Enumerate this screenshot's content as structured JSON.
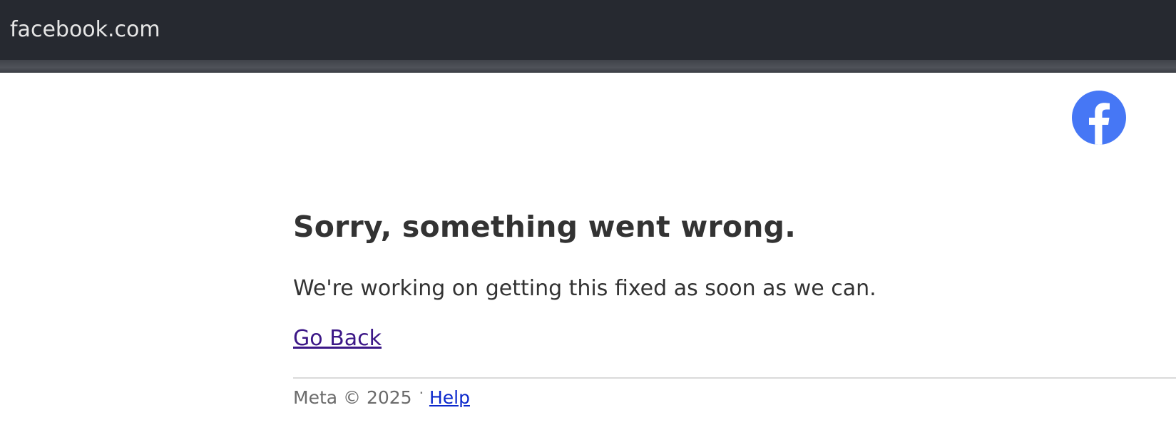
{
  "window": {
    "title": "facebook.com"
  },
  "brand": {
    "icon": "facebook-logo-icon",
    "color": "#4677f5"
  },
  "error": {
    "heading": "Sorry, something went wrong.",
    "message": "We're working on getting this fixed as soon as we can.",
    "go_back_label": "Go Back"
  },
  "footer": {
    "copyright": "Meta © 2025",
    "separator": "·",
    "help_label": "Help"
  },
  "colors": {
    "titlebar_bg": "#262930",
    "text": "#333333",
    "visited_link": "#3c1787",
    "link": "#0b28cc",
    "muted": "#6b6b6b"
  }
}
